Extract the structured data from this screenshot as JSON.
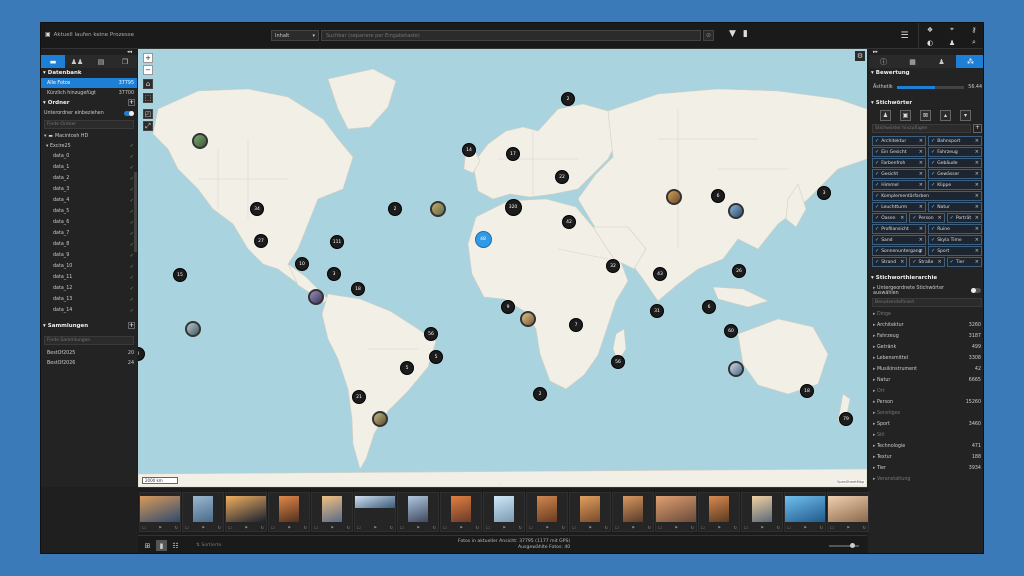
{
  "topbar": {
    "process_status": "Aktuell laufen keine Prozesse",
    "scope": "Inhalt",
    "search_placeholder": "Suchbar (separiere per Eingabetaste)"
  },
  "left": {
    "tabs": [
      "folder-icon",
      "people-icon",
      "doc-icon",
      "copy-icon"
    ],
    "db_title": "Datenbank",
    "db_items": [
      {
        "label": "Alle Fotos",
        "count": "37795"
      },
      {
        "label": "Kürzlich hinzugefügt",
        "count": "37700"
      }
    ],
    "folders_title": "Ordner",
    "subfolders_label": "Unterordner einbeziehen",
    "folder_search_placeholder": "Finde Ordner",
    "root": "Macintosh HD",
    "parent": "Excire25",
    "folders": [
      "data_0",
      "data_1",
      "data_2",
      "data_3",
      "data_4",
      "data_5",
      "data_6",
      "data_7",
      "data_8",
      "data_9",
      "data_10",
      "data_11",
      "data_12",
      "data_13",
      "data_14"
    ],
    "collections_title": "Sammlungen",
    "collections_search_placeholder": "Finde Sammlungen",
    "collections": [
      {
        "label": "BestOf2025",
        "count": "20"
      },
      {
        "label": "BestOf2026",
        "count": "24"
      }
    ]
  },
  "map": {
    "scale": "2000 km",
    "attribution": "OpenStreetMap",
    "clusters": [
      {
        "n": "2"
      },
      {
        "n": "14"
      },
      {
        "n": "17"
      },
      {
        "n": "22"
      },
      {
        "n": "320"
      },
      {
        "n": "42"
      },
      {
        "n": "2"
      },
      {
        "n": "6"
      },
      {
        "n": "3"
      },
      {
        "n": "34"
      },
      {
        "n": "27"
      },
      {
        "n": "111"
      },
      {
        "n": "10"
      },
      {
        "n": "3"
      },
      {
        "n": "15"
      },
      {
        "n": "18"
      },
      {
        "n": "32"
      },
      {
        "n": "43"
      },
      {
        "n": "26"
      },
      {
        "n": "6"
      },
      {
        "n": "9"
      },
      {
        "n": "7"
      },
      {
        "n": "31"
      },
      {
        "n": "60"
      },
      {
        "n": "56"
      },
      {
        "n": "5"
      },
      {
        "n": "56"
      },
      {
        "n": "2"
      },
      {
        "n": "21"
      },
      {
        "n": "18"
      },
      {
        "n": "79"
      },
      {
        "n": "2"
      },
      {
        "n": "5"
      },
      {
        "n": "48"
      }
    ]
  },
  "right": {
    "rating_title": "Bewertung",
    "aesthetic_label": "Ästhetik",
    "aesthetic_value": "56.44",
    "aesthetic_fraction": 0.56,
    "keywords_title": "Stichwörter",
    "keyword_input_placeholder": "Stichwörter hinzufügen",
    "keywords": [
      [
        "Architektur",
        "Bahnsport"
      ],
      [
        "Ein Gesicht",
        "Fahrzeug"
      ],
      [
        "Farbenfroh",
        "Gebäude"
      ],
      [
        "Gesicht",
        "Gewässer"
      ],
      [
        "Himmel",
        "Klippe"
      ],
      [
        "Komplementärfarben"
      ],
      [
        "Leuchtturm",
        "Natur"
      ],
      [
        "Oasen",
        "Person",
        "Porträt"
      ],
      [
        "Profilansicht",
        "Ruine"
      ],
      [
        "Sand",
        "Skyla Time"
      ],
      [
        "Sonnenuntergang",
        "Sport"
      ],
      [
        "Strand",
        "Straße",
        "Tier"
      ]
    ],
    "hierarchy_title": "Stichworthierarchie",
    "subordinate_label": "Untergeordnete Stichwörter auswählen",
    "hierarchy_search_placeholder": "Benutzerdefiniert",
    "hierarchy": [
      {
        "label": "Dinge",
        "count": "",
        "dim": true
      },
      {
        "label": "Architektur",
        "count": "3260"
      },
      {
        "label": "Fahrzeug",
        "count": "3187"
      },
      {
        "label": "Getränk",
        "count": "499"
      },
      {
        "label": "Lebensmittel",
        "count": "3308"
      },
      {
        "label": "Musikinstrument",
        "count": "42"
      },
      {
        "label": "Natur",
        "count": "6665"
      },
      {
        "label": "Ort",
        "count": "",
        "dim": true
      },
      {
        "label": "Person",
        "count": "15260"
      },
      {
        "label": "Sonstiges",
        "count": "",
        "dim": true
      },
      {
        "label": "Sport",
        "count": "3460"
      },
      {
        "label": "Stil",
        "count": "",
        "dim": true
      },
      {
        "label": "Technologie",
        "count": "471"
      },
      {
        "label": "Textur",
        "count": "188"
      },
      {
        "label": "Tier",
        "count": "3934"
      },
      {
        "label": "Veranstaltung",
        "count": "",
        "dim": true
      }
    ]
  },
  "status": {
    "sort_label": "Sortierte",
    "count_line1": "Fotos in aktueller Ansicht:  37795  (1177 mit GPS)",
    "count_line2": "Ausgewählte Fotos:  40"
  },
  "colors": {
    "accent": "#1e7fd6",
    "water": "#a9d3df",
    "land": "#f1efe6",
    "cluster": "#1c1c1c",
    "cluster_selected": "#2f9be8"
  }
}
